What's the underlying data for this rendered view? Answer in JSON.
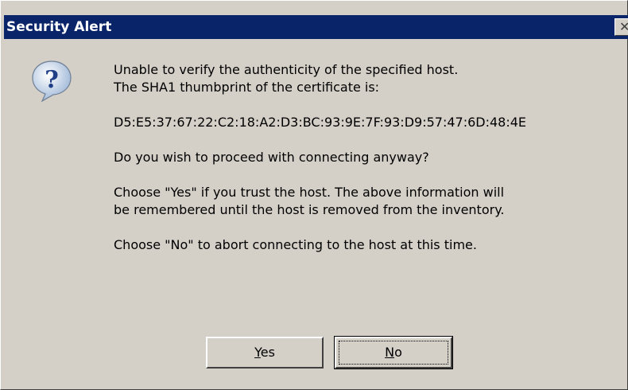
{
  "window": {
    "title": "Security Alert",
    "close_glyph": "✕"
  },
  "icon": {
    "name": "question-icon"
  },
  "message": {
    "line1": "Unable to verify the authenticity of the specified host.",
    "line2": "The SHA1 thumbprint of the certificate is:",
    "thumbprint": "D5:E5:37:67:22:C2:18:A2:D3:BC:93:9E:7F:93:D9:57:47:6D:48:4E",
    "question": "Do you wish to proceed with connecting anyway?",
    "yes_info_line1": "Choose \"Yes\" if you trust the host. The above information will",
    "yes_info_line2": "be remembered until the host is removed from the inventory.",
    "no_info": "Choose \"No\" to abort connecting to the host at this time."
  },
  "buttons": {
    "yes": {
      "mnemonic": "Y",
      "rest": "es"
    },
    "no": {
      "mnemonic": "N",
      "rest": "o"
    }
  },
  "colors": {
    "titlebar": "#0a246a",
    "face": "#d4d0c8"
  }
}
